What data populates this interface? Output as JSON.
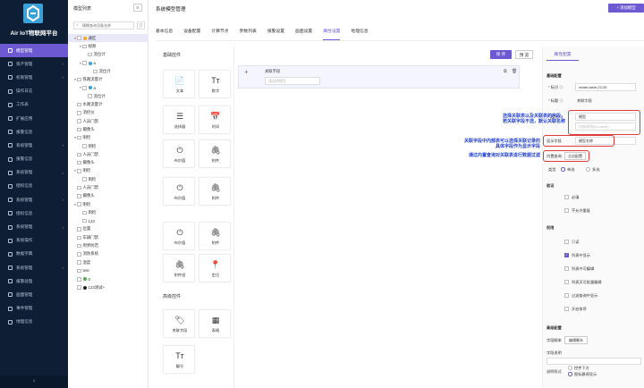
{
  "sidebar": {
    "brand": "Air IoT物联网平台",
    "items": [
      {
        "label": "模型管理",
        "active": true
      },
      {
        "label": "资产管理",
        "arrow": "›"
      },
      {
        "label": "权限管理",
        "arrow": "›"
      },
      {
        "label": "操作日志"
      },
      {
        "label": "工作表"
      },
      {
        "label": "扩展应用"
      },
      {
        "label": "报警信息"
      },
      {
        "label": "系统管理",
        "arrow": "›"
      },
      {
        "label": "报警信息"
      },
      {
        "label": "系统管理",
        "arrow": "›"
      },
      {
        "label": "授权信息"
      },
      {
        "label": "系统管理",
        "arrow": "›"
      },
      {
        "label": "授权信息"
      },
      {
        "label": "系统管理",
        "arrow": "›"
      },
      {
        "label": "系统操作"
      },
      {
        "label": "数据字典"
      },
      {
        "label": "系统管理",
        "arrow": "›"
      },
      {
        "label": "报警处理"
      },
      {
        "label": "画面管理"
      },
      {
        "label": "事件管理"
      },
      {
        "label": "地理信息"
      }
    ],
    "collapse_icon": "‹"
  },
  "tree": {
    "header": "模型列表",
    "menu_icon": "≡",
    "search_placeholder": "模糊查询设备名称",
    "search_icon": "⌕",
    "filter_icon": "▽",
    "rows": [
      {
        "indent": 0,
        "toggle": "▾",
        "label": "通区",
        "selected": true,
        "color": "#f5a623"
      },
      {
        "indent": 1,
        "toggle": "▾",
        "label": "视频",
        "color": ""
      },
      {
        "indent": 2,
        "toggle": "",
        "label": "流位计",
        "color": ""
      },
      {
        "indent": 1,
        "toggle": "▾",
        "label": "a",
        "color": "#3aa0d8"
      },
      {
        "indent": 3,
        "toggle": "",
        "label": "流位计",
        "color": ""
      },
      {
        "indent": 0,
        "toggle": "▾",
        "label": "铁路流量计",
        "color": ""
      },
      {
        "indent": 1,
        "toggle": "▾",
        "label": "a",
        "color": "#3aa0d8"
      },
      {
        "indent": 2,
        "toggle": "",
        "label": "流位计",
        "color": ""
      },
      {
        "indent": 0,
        "toggle": "",
        "label": "水路流量计",
        "color": ""
      },
      {
        "indent": 0,
        "toggle": "",
        "label": "消控仪",
        "color": ""
      },
      {
        "indent": 0,
        "toggle": "",
        "label": "人员门禁",
        "color": ""
      },
      {
        "indent": 0,
        "toggle": "",
        "label": "摄像头",
        "color": ""
      },
      {
        "indent": 0,
        "toggle": "▾",
        "label": "明检",
        "color": ""
      },
      {
        "indent": 1,
        "toggle": "",
        "label": "明检",
        "color": ""
      },
      {
        "indent": 0,
        "toggle": "",
        "label": "人员门禁",
        "color": ""
      },
      {
        "indent": 0,
        "toggle": "",
        "label": "摄像头",
        "color": ""
      },
      {
        "indent": 0,
        "toggle": "▾",
        "label": "明检",
        "color": ""
      },
      {
        "indent": 1,
        "toggle": "",
        "label": "明检",
        "color": ""
      },
      {
        "indent": 0,
        "toggle": "",
        "label": "人员门禁",
        "color": ""
      },
      {
        "indent": 0,
        "toggle": "",
        "label": "摄像头",
        "color": ""
      },
      {
        "indent": 0,
        "toggle": "▾",
        "label": "明检",
        "color": ""
      },
      {
        "indent": 1,
        "toggle": "",
        "label": "明检",
        "color": ""
      },
      {
        "indent": 1,
        "toggle": "",
        "label": "123",
        "color": ""
      },
      {
        "indent": 0,
        "toggle": "",
        "label": "位置",
        "color": ""
      },
      {
        "indent": 0,
        "toggle": "",
        "label": "车辆门禁",
        "color": ""
      },
      {
        "indent": 0,
        "toggle": "",
        "label": "周界防范",
        "color": ""
      },
      {
        "indent": 0,
        "toggle": "",
        "label": "消防系统",
        "color": ""
      },
      {
        "indent": 0,
        "toggle": "",
        "label": "温度",
        "color": ""
      },
      {
        "indent": 0,
        "toggle": "",
        "label": "test",
        "color": ""
      },
      {
        "indent": 0,
        "toggle": "",
        "label": "0",
        "color": "#4caf50"
      },
      {
        "indent": 0,
        "toggle": "",
        "label": "123测试+",
        "color": "#222"
      }
    ]
  },
  "main": {
    "title": "系统模型管理",
    "add_button": "+ 添加模型",
    "tabs": [
      {
        "label": "基本信息"
      },
      {
        "label": "设备配置"
      },
      {
        "label": "计算节点"
      },
      {
        "label": "参数列表"
      },
      {
        "label": "报警设置"
      },
      {
        "label": "画面设置"
      },
      {
        "label": "属性设置",
        "active": true
      },
      {
        "label": "地理信息"
      }
    ]
  },
  "palette": {
    "basic_title": "基础控件",
    "basic": [
      {
        "label": "文本",
        "icon": "📄"
      },
      {
        "label": "数字",
        "icon": "Tт"
      },
      {
        "label": "选择器",
        "icon": "☰"
      },
      {
        "label": "时间",
        "icon": "📅"
      },
      {
        "label": "布尔值",
        "icon": "⏻"
      },
      {
        "label": "附件",
        "icon": "🖇"
      },
      {
        "label": "布尔值",
        "icon": "⏻"
      },
      {
        "label": "附件",
        "icon": "🖇"
      },
      {
        "label": "布尔值",
        "icon": "⏻"
      },
      {
        "label": "附件",
        "icon": "🖇"
      },
      {
        "label": "附件组",
        "icon": "🖇"
      },
      {
        "label": "定位",
        "icon": "📍"
      }
    ],
    "advanced_title": "高级控件",
    "advanced": [
      {
        "label": "关联字段",
        "icon": "🏷"
      },
      {
        "label": "表格",
        "icon": "▦"
      },
      {
        "label": "编号",
        "icon": "Tт"
      }
    ]
  },
  "canvas": {
    "save": "保 存",
    "preview": "预 览",
    "plus_icon": "+",
    "field_label": "关联字段",
    "field_placeholder": "请选择模型",
    "copy_icon": "⧉",
    "delete_icon": "🗑"
  },
  "props": {
    "tab": "属性配置",
    "basic_config": "基础配置",
    "id_label": "标识",
    "id_value": "relate-table-2C2D",
    "title_label": "标题",
    "title_value": "关联字段",
    "table_label": "表名",
    "table_value": "模型",
    "table_placeholder": "内部表明(Ui.name)",
    "display_label": "显示字段",
    "display_value": "模型名称",
    "builtin_label": "内置查询",
    "builtin_button": "点击配置",
    "type_label": "类型",
    "type_options": [
      "单选",
      "多选"
    ],
    "validation_title": "验证",
    "validation": [
      "必填",
      "不允许重复"
    ],
    "perm_title": "权限",
    "perms": [
      {
        "label": "只读",
        "on": false
      },
      {
        "label": "列表中显示",
        "on": true
      },
      {
        "label": "列表中可编辑",
        "on": false
      },
      {
        "label": "列表页可批量编辑",
        "on": false
      },
      {
        "label": "过滤查询中显示",
        "on": false
      },
      {
        "label": "开启排序",
        "on": false
      }
    ],
    "advanced_title": "高级配置",
    "script_label": "字段脚本",
    "script_button": "编辑脚本",
    "desc_label": "字段说明",
    "desc_style_label": "说明形式",
    "desc_options": [
      "控件下方",
      "图标悬停显示"
    ]
  },
  "annotations": {
    "note1": [
      "选择关联表以及关联表的字段，",
      "若关联字段不选，默认关联名称"
    ],
    "note2": [
      "关联字段中内部表可以选择关联记录的",
      "具体字段作为显示字段"
    ],
    "note3": [
      "通过内置查询对关联表进行数据过滤"
    ],
    "color": "#1f3fd0",
    "box_color": "#e03b3b"
  }
}
